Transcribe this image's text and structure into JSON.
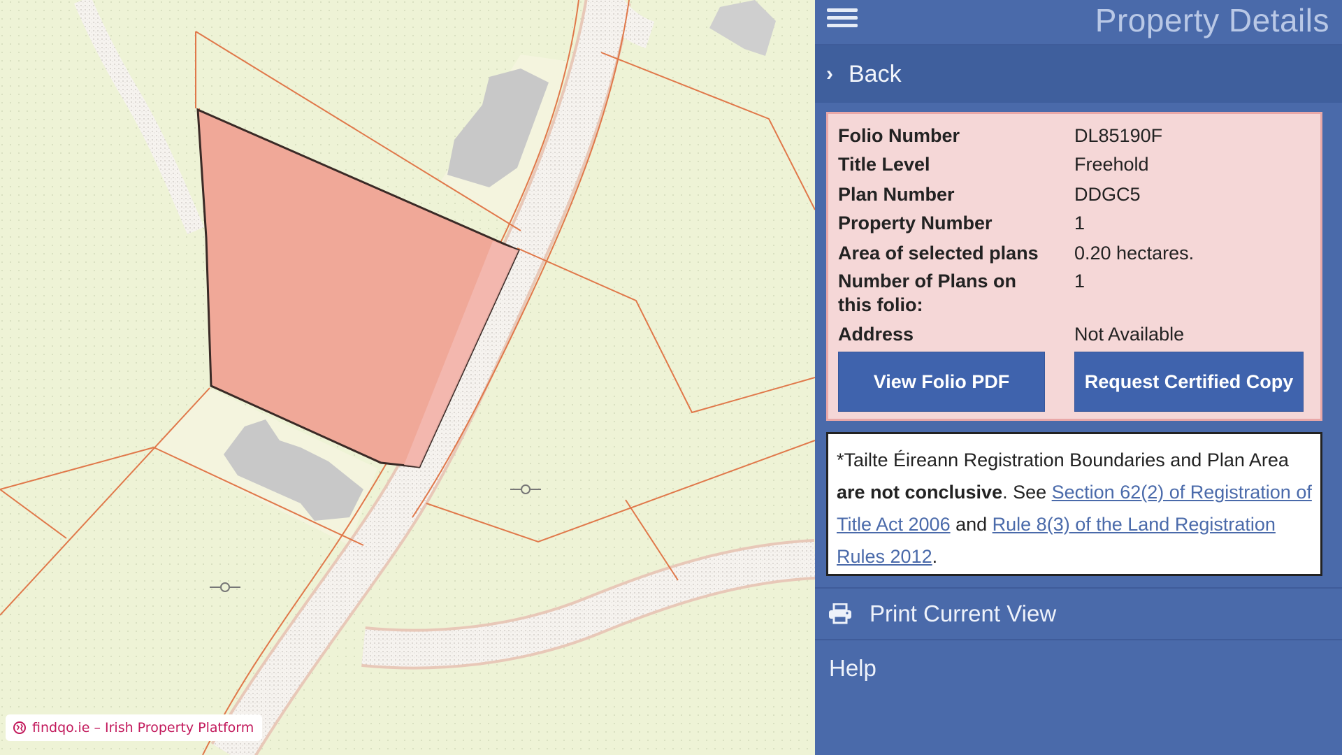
{
  "map": {
    "watermark_text": "findqo.ie – Irish Property Platform"
  },
  "header": {
    "menu_icon": "hamburger-menu-icon",
    "title": "Property Details"
  },
  "back": {
    "icon": "chevron-right-icon",
    "label": "Back"
  },
  "details": {
    "rows": [
      {
        "label": "Folio Number",
        "value": "DL85190F"
      },
      {
        "label": "Title Level",
        "value": "Freehold"
      },
      {
        "label": "Plan Number",
        "value": "DDGC5"
      },
      {
        "label": "Property Number",
        "value": "1"
      },
      {
        "label": "Area of selected plans",
        "value": "0.20 hectares."
      },
      {
        "label": "Number of Plans on this folio:",
        "value": "1"
      },
      {
        "label": "Address",
        "value": "Not Available"
      }
    ],
    "view_folio_label": "View Folio PDF",
    "request_copy_label": "Request Certified Copy"
  },
  "notice": {
    "part1": "*Tailte Éireann Registration Boundaries and Plan Area ",
    "bold": "are not conclusive",
    "part2": ". See ",
    "link1": "Section 62(2) of Registration of Title Act 2006",
    "part3": " and ",
    "link2": "Rule 8(3) of the Land Registration Rules 2012",
    "part4": "."
  },
  "menu": {
    "print_icon": "printer-icon",
    "print_label": "Print Current View",
    "help_label": "Help"
  },
  "colors": {
    "panel_bg": "#4a6aaa",
    "parcel_fill": "#f0a898",
    "details_bg": "#f5d7d7",
    "button_bg": "#3f63ad",
    "link": "#4a6aaa"
  }
}
